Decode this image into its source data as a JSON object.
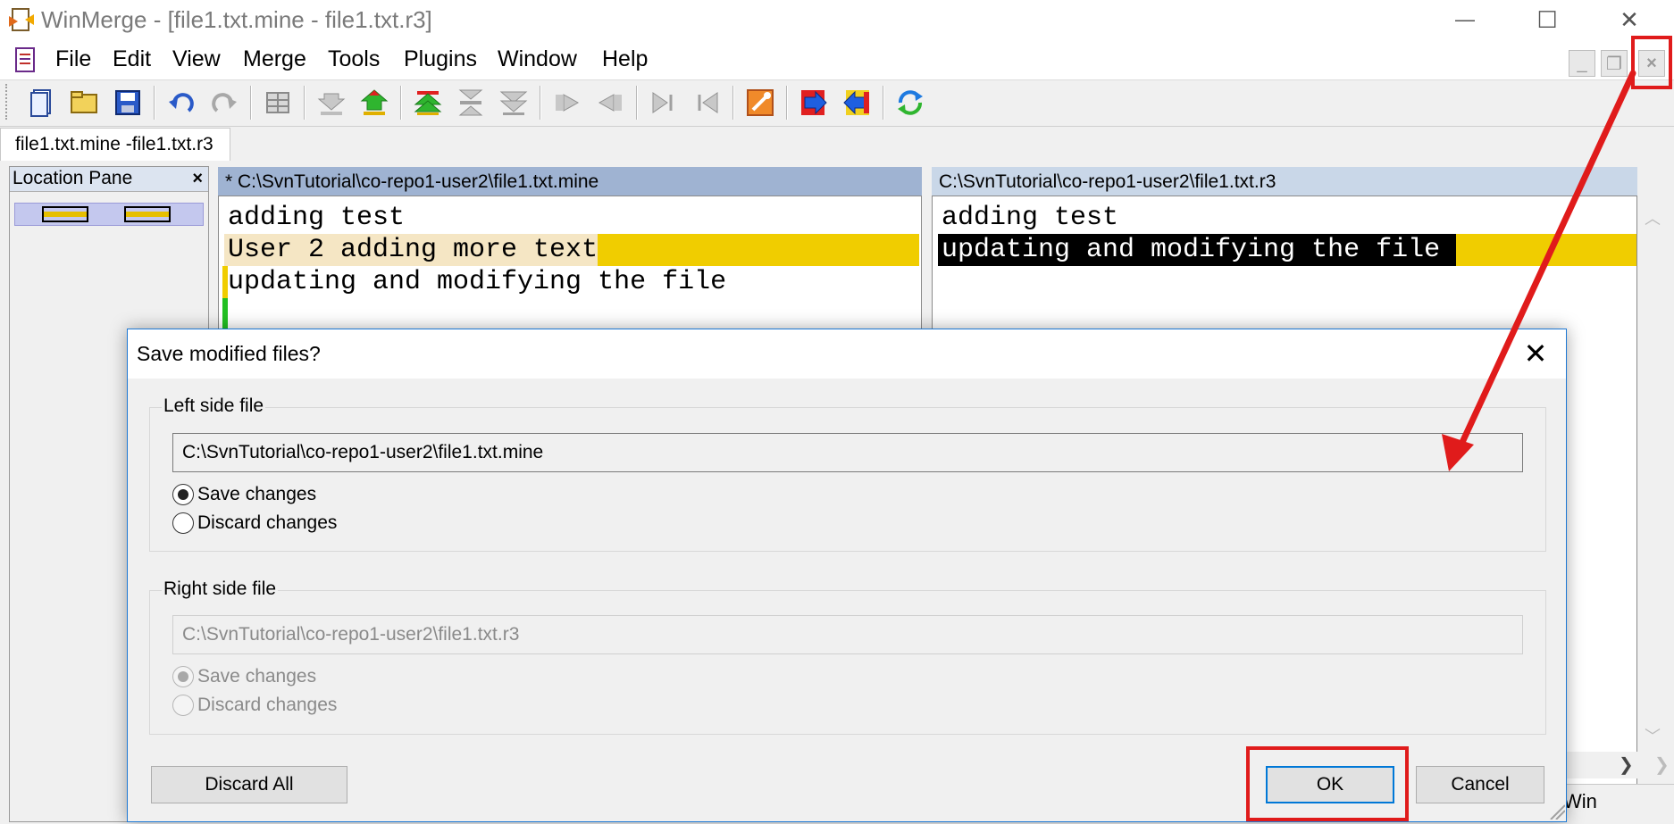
{
  "window": {
    "title": "WinMerge - [file1.txt.mine - file1.txt.r3]",
    "minimize_glyph": "—",
    "maximize_glyph": "☐",
    "close_glyph": "✕"
  },
  "menu": {
    "items": [
      {
        "label": "File"
      },
      {
        "label": "Edit"
      },
      {
        "label": "View"
      },
      {
        "label": "Merge"
      },
      {
        "label": "Tools"
      },
      {
        "label": "Plugins"
      },
      {
        "label": "Window"
      },
      {
        "label": "Help"
      }
    ],
    "mdi_minimize": "_",
    "mdi_restore": "❐",
    "mdi_close": "×"
  },
  "toolbar": {
    "icons": [
      "new-file-icon",
      "open-folder-icon",
      "save-icon",
      "undo-icon",
      "redo-icon",
      "options-icon",
      "next-diff-down-icon",
      "next-diff-up-icon",
      "first-diff-icon",
      "current-diff-icon",
      "last-diff-icon",
      "copy-right-icon",
      "copy-left-icon",
      "copy-right-advance-icon",
      "copy-left-advance-icon",
      "tools-icon",
      "merge-right-icon",
      "merge-left-icon",
      "refresh-icon"
    ]
  },
  "document_tab": {
    "label": "file1.txt.mine -file1.txt.r3"
  },
  "location_pane": {
    "title": "Location Pane",
    "close": "×"
  },
  "left_pane": {
    "path": "* C:\\SvnTutorial\\co-repo1-user2\\file1.txt.mine",
    "lines": [
      "adding test",
      "User 2 adding more text",
      "updating and modifying the file"
    ]
  },
  "right_pane": {
    "path": "C:\\SvnTutorial\\co-repo1-user2\\file1.txt.r3",
    "lines": [
      "adding test",
      "updating and modifying the file "
    ]
  },
  "status": {
    "partial_text": "Win"
  },
  "dialog": {
    "title": "Save modified files?",
    "close": "✕",
    "left_group": {
      "title": "Left side file",
      "path": "C:\\SvnTutorial\\co-repo1-user2\\file1.txt.mine",
      "save_label": "Save changes",
      "discard_label": "Discard changes",
      "selected": "save"
    },
    "right_group": {
      "title": "Right side file",
      "path": "C:\\SvnTutorial\\co-repo1-user2\\file1.txt.r3",
      "save_label": "Save changes",
      "discard_label": "Discard changes",
      "selected": "save",
      "disabled": true
    },
    "discard_all_label": "Discard All",
    "ok_label": "OK",
    "cancel_label": "Cancel"
  },
  "colors": {
    "diff_highlight": "#f0cd00",
    "diff_line_bg": "#f5e6c4",
    "selection_bg": "#000000",
    "annotation_red": "#e01b1b",
    "left_header": "#9fb3d2",
    "right_header": "#c9d7e8"
  }
}
